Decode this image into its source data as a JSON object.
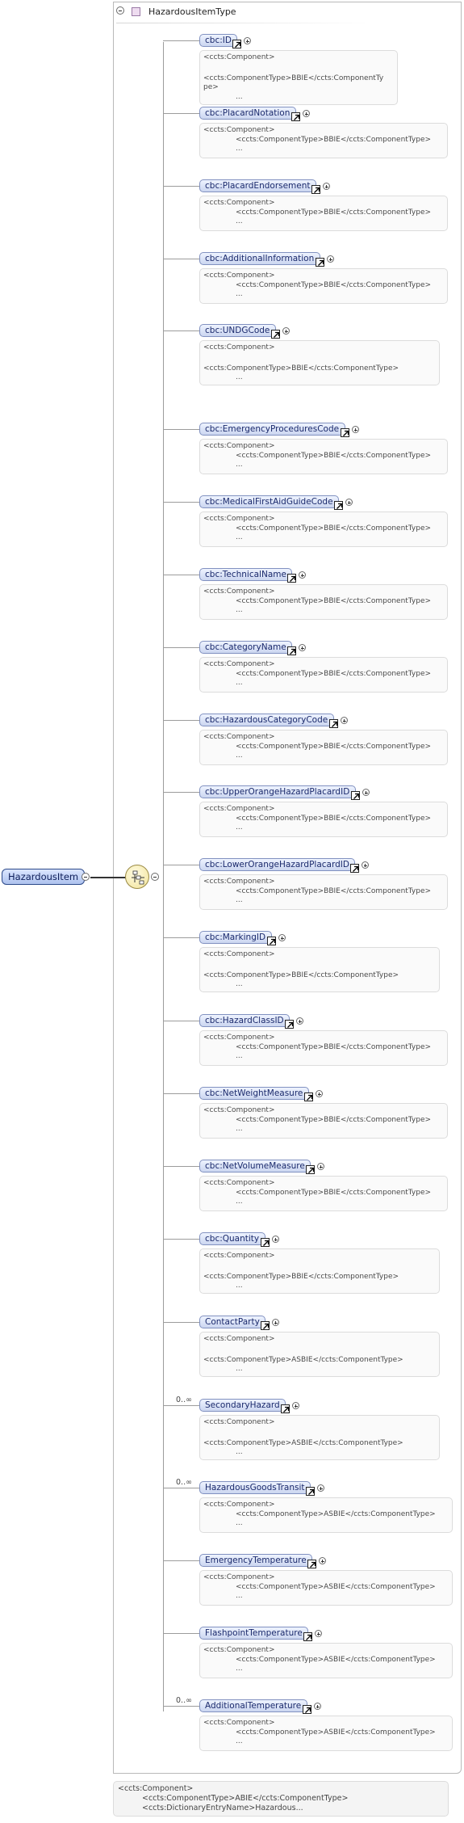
{
  "type_name": "HazardousItemType",
  "root_element": "HazardousItem",
  "card_text": {
    "component": "<ccts:Component>",
    "component_type_bbie": "<ccts:ComponentType>BBIE</ccts:ComponentType>",
    "component_type_asbie": "<ccts:ComponentType>ASBIE</ccts:ComponentType>",
    "wrap_first": "<ccts:ComponentType>BBIE</ccts:ComponentTy",
    "wrap_second": "pe>",
    "ellipsis": "..."
  },
  "elements": [
    {
      "name": "cbc:ID",
      "multiplicity": "",
      "card": "wrap"
    },
    {
      "name": "cbc:PlacardNotation",
      "multiplicity": "",
      "card": "bbie_inline"
    },
    {
      "name": "cbc:PlacardEndorsement",
      "multiplicity": "",
      "card": "bbie_inline"
    },
    {
      "name": "cbc:AdditionalInformation",
      "multiplicity": "",
      "card": "bbie_inline"
    },
    {
      "name": "cbc:UNDGCode",
      "multiplicity": "",
      "card": "bbie_block"
    },
    {
      "name": "cbc:EmergencyProceduresCode",
      "multiplicity": "",
      "card": "bbie_inline"
    },
    {
      "name": "cbc:MedicalFirstAidGuideCode",
      "multiplicity": "",
      "card": "bbie_inline"
    },
    {
      "name": "cbc:TechnicalName",
      "multiplicity": "",
      "card": "bbie_inline"
    },
    {
      "name": "cbc:CategoryName",
      "multiplicity": "",
      "card": "bbie_inline"
    },
    {
      "name": "cbc:HazardousCategoryCode",
      "multiplicity": "",
      "card": "bbie_inline"
    },
    {
      "name": "cbc:UpperOrangeHazardPlacardID",
      "multiplicity": "",
      "card": "bbie_inline"
    },
    {
      "name": "cbc:LowerOrangeHazardPlacardID",
      "multiplicity": "",
      "card": "bbie_inline"
    },
    {
      "name": "cbc:MarkingID",
      "multiplicity": "",
      "card": "bbie_block"
    },
    {
      "name": "cbc:HazardClassID",
      "multiplicity": "",
      "card": "bbie_inline"
    },
    {
      "name": "cbc:NetWeightMeasure",
      "multiplicity": "",
      "card": "bbie_inline"
    },
    {
      "name": "cbc:NetVolumeMeasure",
      "multiplicity": "",
      "card": "bbie_inline"
    },
    {
      "name": "cbc:Quantity",
      "multiplicity": "",
      "card": "bbie_block"
    },
    {
      "name": "ContactParty",
      "multiplicity": "",
      "card": "asbie_block"
    },
    {
      "name": "SecondaryHazard",
      "multiplicity": "0..∞",
      "card": "asbie_block"
    },
    {
      "name": "HazardousGoodsTransit",
      "multiplicity": "0..∞",
      "card": "asbie_inline"
    },
    {
      "name": "EmergencyTemperature",
      "multiplicity": "",
      "card": "asbie_inline"
    },
    {
      "name": "FlashpointTemperature",
      "multiplicity": "",
      "card": "asbie_inline"
    },
    {
      "name": "AdditionalTemperature",
      "multiplicity": "0..∞",
      "card": "asbie_inline"
    }
  ],
  "footer": {
    "line1": "<ccts:Component>",
    "line2": "<ccts:ComponentType>ABIE</ccts:ComponentType>",
    "line3": "<ccts:DictionaryEntryName>Hazardous..."
  }
}
